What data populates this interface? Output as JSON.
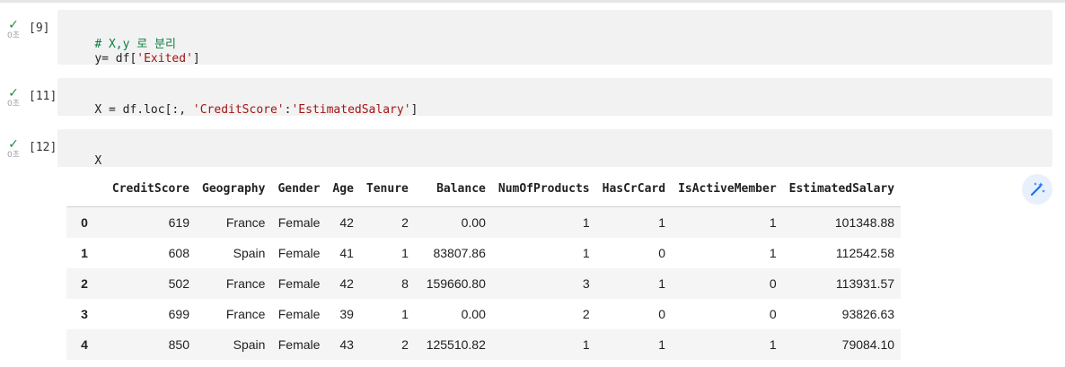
{
  "cells": [
    {
      "exec_count": "[9]",
      "status_time": "0초",
      "lines": [
        {
          "tokens": [
            {
              "text": "# X,y 로 분리",
              "kind": "comment"
            }
          ]
        },
        {
          "tokens": [
            {
              "text": "y= df[",
              "kind": "code"
            },
            {
              "text": "'Exited'",
              "kind": "string"
            },
            {
              "text": "]",
              "kind": "code"
            }
          ]
        }
      ]
    },
    {
      "exec_count": "[11]",
      "status_time": "0초",
      "lines": [
        {
          "tokens": [
            {
              "text": "X = df.loc[:, ",
              "kind": "code"
            },
            {
              "text": "'CreditScore'",
              "kind": "string"
            },
            {
              "text": ":",
              "kind": "code"
            },
            {
              "text": "'EstimatedSalary'",
              "kind": "string"
            },
            {
              "text": "]",
              "kind": "code"
            }
          ]
        }
      ]
    },
    {
      "exec_count": "[12]",
      "status_time": "0초",
      "lines": [
        {
          "tokens": [
            {
              "text": "X",
              "kind": "code"
            }
          ]
        }
      ]
    }
  ],
  "dataframe": {
    "columns": [
      "",
      "CreditScore",
      "Geography",
      "Gender",
      "Age",
      "Tenure",
      "Balance",
      "NumOfProducts",
      "HasCrCard",
      "IsActiveMember",
      "EstimatedSalary"
    ],
    "rows": [
      [
        "0",
        "619",
        "France",
        "Female",
        "42",
        "2",
        "0.00",
        "1",
        "1",
        "1",
        "101348.88"
      ],
      [
        "1",
        "608",
        "Spain",
        "Female",
        "41",
        "1",
        "83807.86",
        "1",
        "0",
        "1",
        "112542.58"
      ],
      [
        "2",
        "502",
        "France",
        "Female",
        "42",
        "8",
        "159660.80",
        "3",
        "1",
        "0",
        "113931.57"
      ],
      [
        "3",
        "699",
        "France",
        "Female",
        "39",
        "1",
        "0.00",
        "2",
        "0",
        "0",
        "93826.63"
      ],
      [
        "4",
        "850",
        "Spain",
        "Female",
        "43",
        "2",
        "125510.82",
        "1",
        "1",
        "1",
        "79084.10"
      ]
    ]
  },
  "icons": {
    "status": "check-icon",
    "magic": "magic-wand-icon"
  },
  "colors": {
    "check": "#1e8e3e",
    "comment": "#0b8043",
    "string": "#a31515",
    "magic_bg": "#e8f0fe",
    "magic_fg": "#1a73e8"
  }
}
